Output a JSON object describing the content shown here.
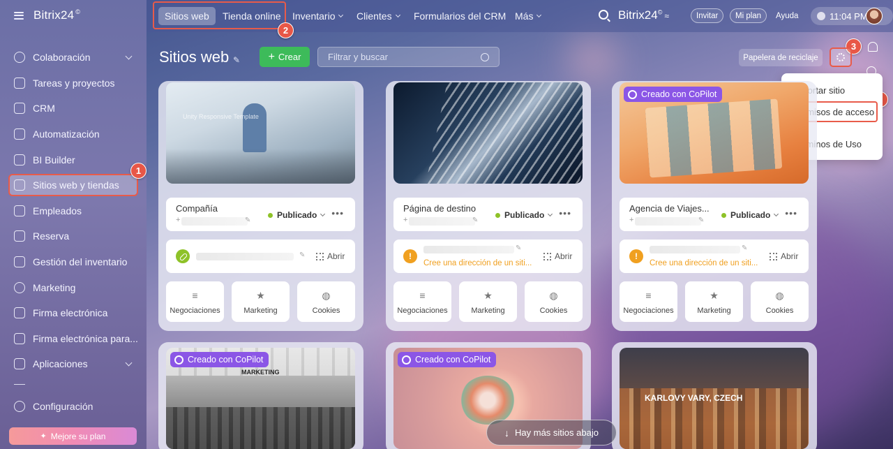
{
  "app": {
    "name": "Bitrix24",
    "mark": "©"
  },
  "sidebar": {
    "items": [
      {
        "label": "Colaboración",
        "icon": "chat-icon",
        "chevron": true
      },
      {
        "label": "Tareas y proyectos",
        "icon": "checkbox-icon"
      },
      {
        "label": "CRM",
        "icon": "funnel-icon"
      },
      {
        "label": "Automatización",
        "icon": "robot-icon"
      },
      {
        "label": "BI Builder",
        "icon": "chart-icon"
      },
      {
        "label": "Sitios web y tiendas",
        "icon": "cart-icon",
        "active": true
      },
      {
        "label": "Empleados",
        "icon": "people-icon"
      },
      {
        "label": "Reserva",
        "icon": "calendar-icon"
      },
      {
        "label": "Gestión del inventario",
        "icon": "warehouse-icon"
      },
      {
        "label": "Marketing",
        "icon": "target-icon"
      },
      {
        "label": "Firma electrónica",
        "icon": "signature-icon"
      },
      {
        "label": "Firma electrónica para...",
        "icon": "signature-icon"
      },
      {
        "label": "Aplicaciones",
        "icon": "apps-icon",
        "chevron": true
      }
    ],
    "config_label": "Configuración",
    "upgrade_label": "Mejore su plan"
  },
  "topnav": {
    "tabs": [
      {
        "label": "Sitios web",
        "selected": true
      },
      {
        "label": "Tienda online"
      },
      {
        "label": "Inventario",
        "dropdown": true
      },
      {
        "label": "Clientes",
        "dropdown": true
      },
      {
        "label": "Formularios del CRM"
      },
      {
        "label": "Más",
        "dropdown": true
      }
    ],
    "invite_label": "Invitar",
    "plan_label": "Mi plan",
    "help_label": "Ayuda",
    "time": "11:04 PM"
  },
  "header": {
    "title": "Sitios web",
    "create_label": "Crear",
    "search_placeholder": "Filtrar y buscar",
    "trash_label": "Papelera de reciclaje"
  },
  "settings_menu": {
    "items": [
      "Importar sitio",
      "Permisos de acceso",
      "Términos de Uso"
    ]
  },
  "annotations": [
    "1",
    "2",
    "3",
    "4"
  ],
  "cards": [
    {
      "name": "Compañía",
      "status": "Publicado",
      "copilot": false,
      "thumb_caption": "Unity Responsive Template",
      "link_status": "ok",
      "warning": "",
      "open_label": "Abrir",
      "tiles": [
        "Negociaciones",
        "Marketing",
        "Cookies"
      ]
    },
    {
      "name": "Página de destino",
      "status": "Publicado",
      "copilot": false,
      "thumb_caption": "",
      "link_status": "warn",
      "warning": "Cree una dirección de un siti...",
      "open_label": "Abrir",
      "tiles": [
        "Negociaciones",
        "Marketing",
        "Cookies"
      ]
    },
    {
      "name": "Agencia de Viajes...",
      "status": "Publicado",
      "copilot": true,
      "thumb_caption": "",
      "link_status": "warn",
      "warning": "Cree una dirección de un siti...",
      "open_label": "Abrir",
      "tiles": [
        "Negociaciones",
        "Marketing",
        "Cookies"
      ]
    }
  ],
  "bottom_cards": [
    {
      "copilot": true,
      "caption": "MARKETING"
    },
    {
      "copilot": true,
      "caption": ""
    },
    {
      "copilot": false,
      "caption": "KARLOVY VARY, CZECH"
    }
  ],
  "copilot_label": "Creado con CoPilot",
  "more_sites_label": "Hay más sitios abajo"
}
